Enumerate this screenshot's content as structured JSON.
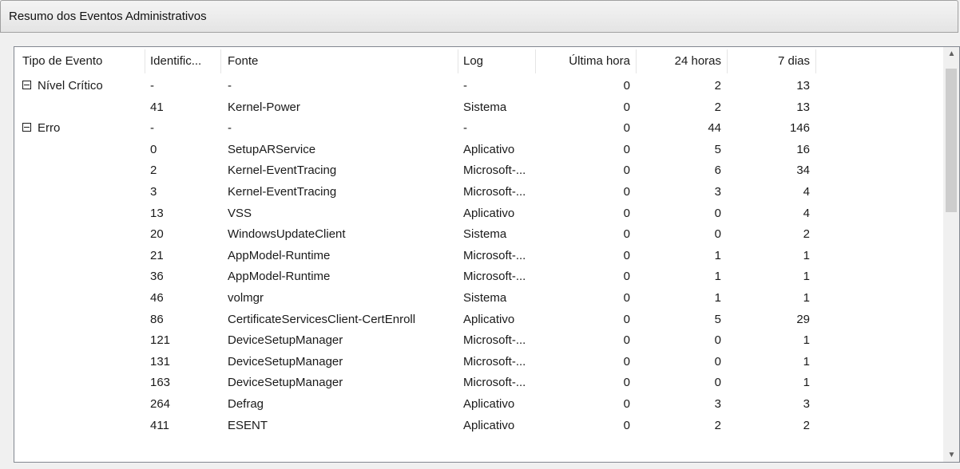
{
  "panel": {
    "title": "Resumo dos Eventos Administrativos"
  },
  "columns": {
    "tipo": "Tipo de Evento",
    "id": "Identific...",
    "fonte": "Fonte",
    "log": "Log",
    "ultima": "Última hora",
    "h24": "24 horas",
    "d7": "7 dias"
  },
  "rows": [
    {
      "tipo": "Nível Crítico",
      "group": true,
      "id": "-",
      "fonte": "-",
      "log": "-",
      "ultima": "0",
      "h24": "2",
      "d7": "13"
    },
    {
      "tipo": "",
      "group": false,
      "id": "41",
      "fonte": "Kernel-Power",
      "log": "Sistema",
      "ultima": "0",
      "h24": "2",
      "d7": "13"
    },
    {
      "tipo": "Erro",
      "group": true,
      "id": "-",
      "fonte": "-",
      "log": "-",
      "ultima": "0",
      "h24": "44",
      "d7": "146"
    },
    {
      "tipo": "",
      "group": false,
      "id": "0",
      "fonte": "SetupARService",
      "log": "Aplicativo",
      "ultima": "0",
      "h24": "5",
      "d7": "16"
    },
    {
      "tipo": "",
      "group": false,
      "id": "2",
      "fonte": "Kernel-EventTracing",
      "log": "Microsoft-...",
      "ultima": "0",
      "h24": "6",
      "d7": "34"
    },
    {
      "tipo": "",
      "group": false,
      "id": "3",
      "fonte": "Kernel-EventTracing",
      "log": "Microsoft-...",
      "ultima": "0",
      "h24": "3",
      "d7": "4"
    },
    {
      "tipo": "",
      "group": false,
      "id": "13",
      "fonte": "VSS",
      "log": "Aplicativo",
      "ultima": "0",
      "h24": "0",
      "d7": "4"
    },
    {
      "tipo": "",
      "group": false,
      "id": "20",
      "fonte": "WindowsUpdateClient",
      "log": "Sistema",
      "ultima": "0",
      "h24": "0",
      "d7": "2"
    },
    {
      "tipo": "",
      "group": false,
      "id": "21",
      "fonte": "AppModel-Runtime",
      "log": "Microsoft-...",
      "ultima": "0",
      "h24": "1",
      "d7": "1"
    },
    {
      "tipo": "",
      "group": false,
      "id": "36",
      "fonte": "AppModel-Runtime",
      "log": "Microsoft-...",
      "ultima": "0",
      "h24": "1",
      "d7": "1"
    },
    {
      "tipo": "",
      "group": false,
      "id": "46",
      "fonte": "volmgr",
      "log": "Sistema",
      "ultima": "0",
      "h24": "1",
      "d7": "1"
    },
    {
      "tipo": "",
      "group": false,
      "id": "86",
      "fonte": "CertificateServicesClient-CertEnroll",
      "log": "Aplicativo",
      "ultima": "0",
      "h24": "5",
      "d7": "29"
    },
    {
      "tipo": "",
      "group": false,
      "id": "121",
      "fonte": "DeviceSetupManager",
      "log": "Microsoft-...",
      "ultima": "0",
      "h24": "0",
      "d7": "1"
    },
    {
      "tipo": "",
      "group": false,
      "id": "131",
      "fonte": "DeviceSetupManager",
      "log": "Microsoft-...",
      "ultima": "0",
      "h24": "0",
      "d7": "1"
    },
    {
      "tipo": "",
      "group": false,
      "id": "163",
      "fonte": "DeviceSetupManager",
      "log": "Microsoft-...",
      "ultima": "0",
      "h24": "0",
      "d7": "1"
    },
    {
      "tipo": "",
      "group": false,
      "id": "264",
      "fonte": "Defrag",
      "log": "Aplicativo",
      "ultima": "0",
      "h24": "3",
      "d7": "3"
    },
    {
      "tipo": "",
      "group": false,
      "id": "411",
      "fonte": "ESENT",
      "log": "Aplicativo",
      "ultima": "0",
      "h24": "2",
      "d7": "2"
    }
  ],
  "scrollbar": {
    "up_icon": "chevron-up-icon",
    "down_icon": "chevron-down-icon"
  }
}
